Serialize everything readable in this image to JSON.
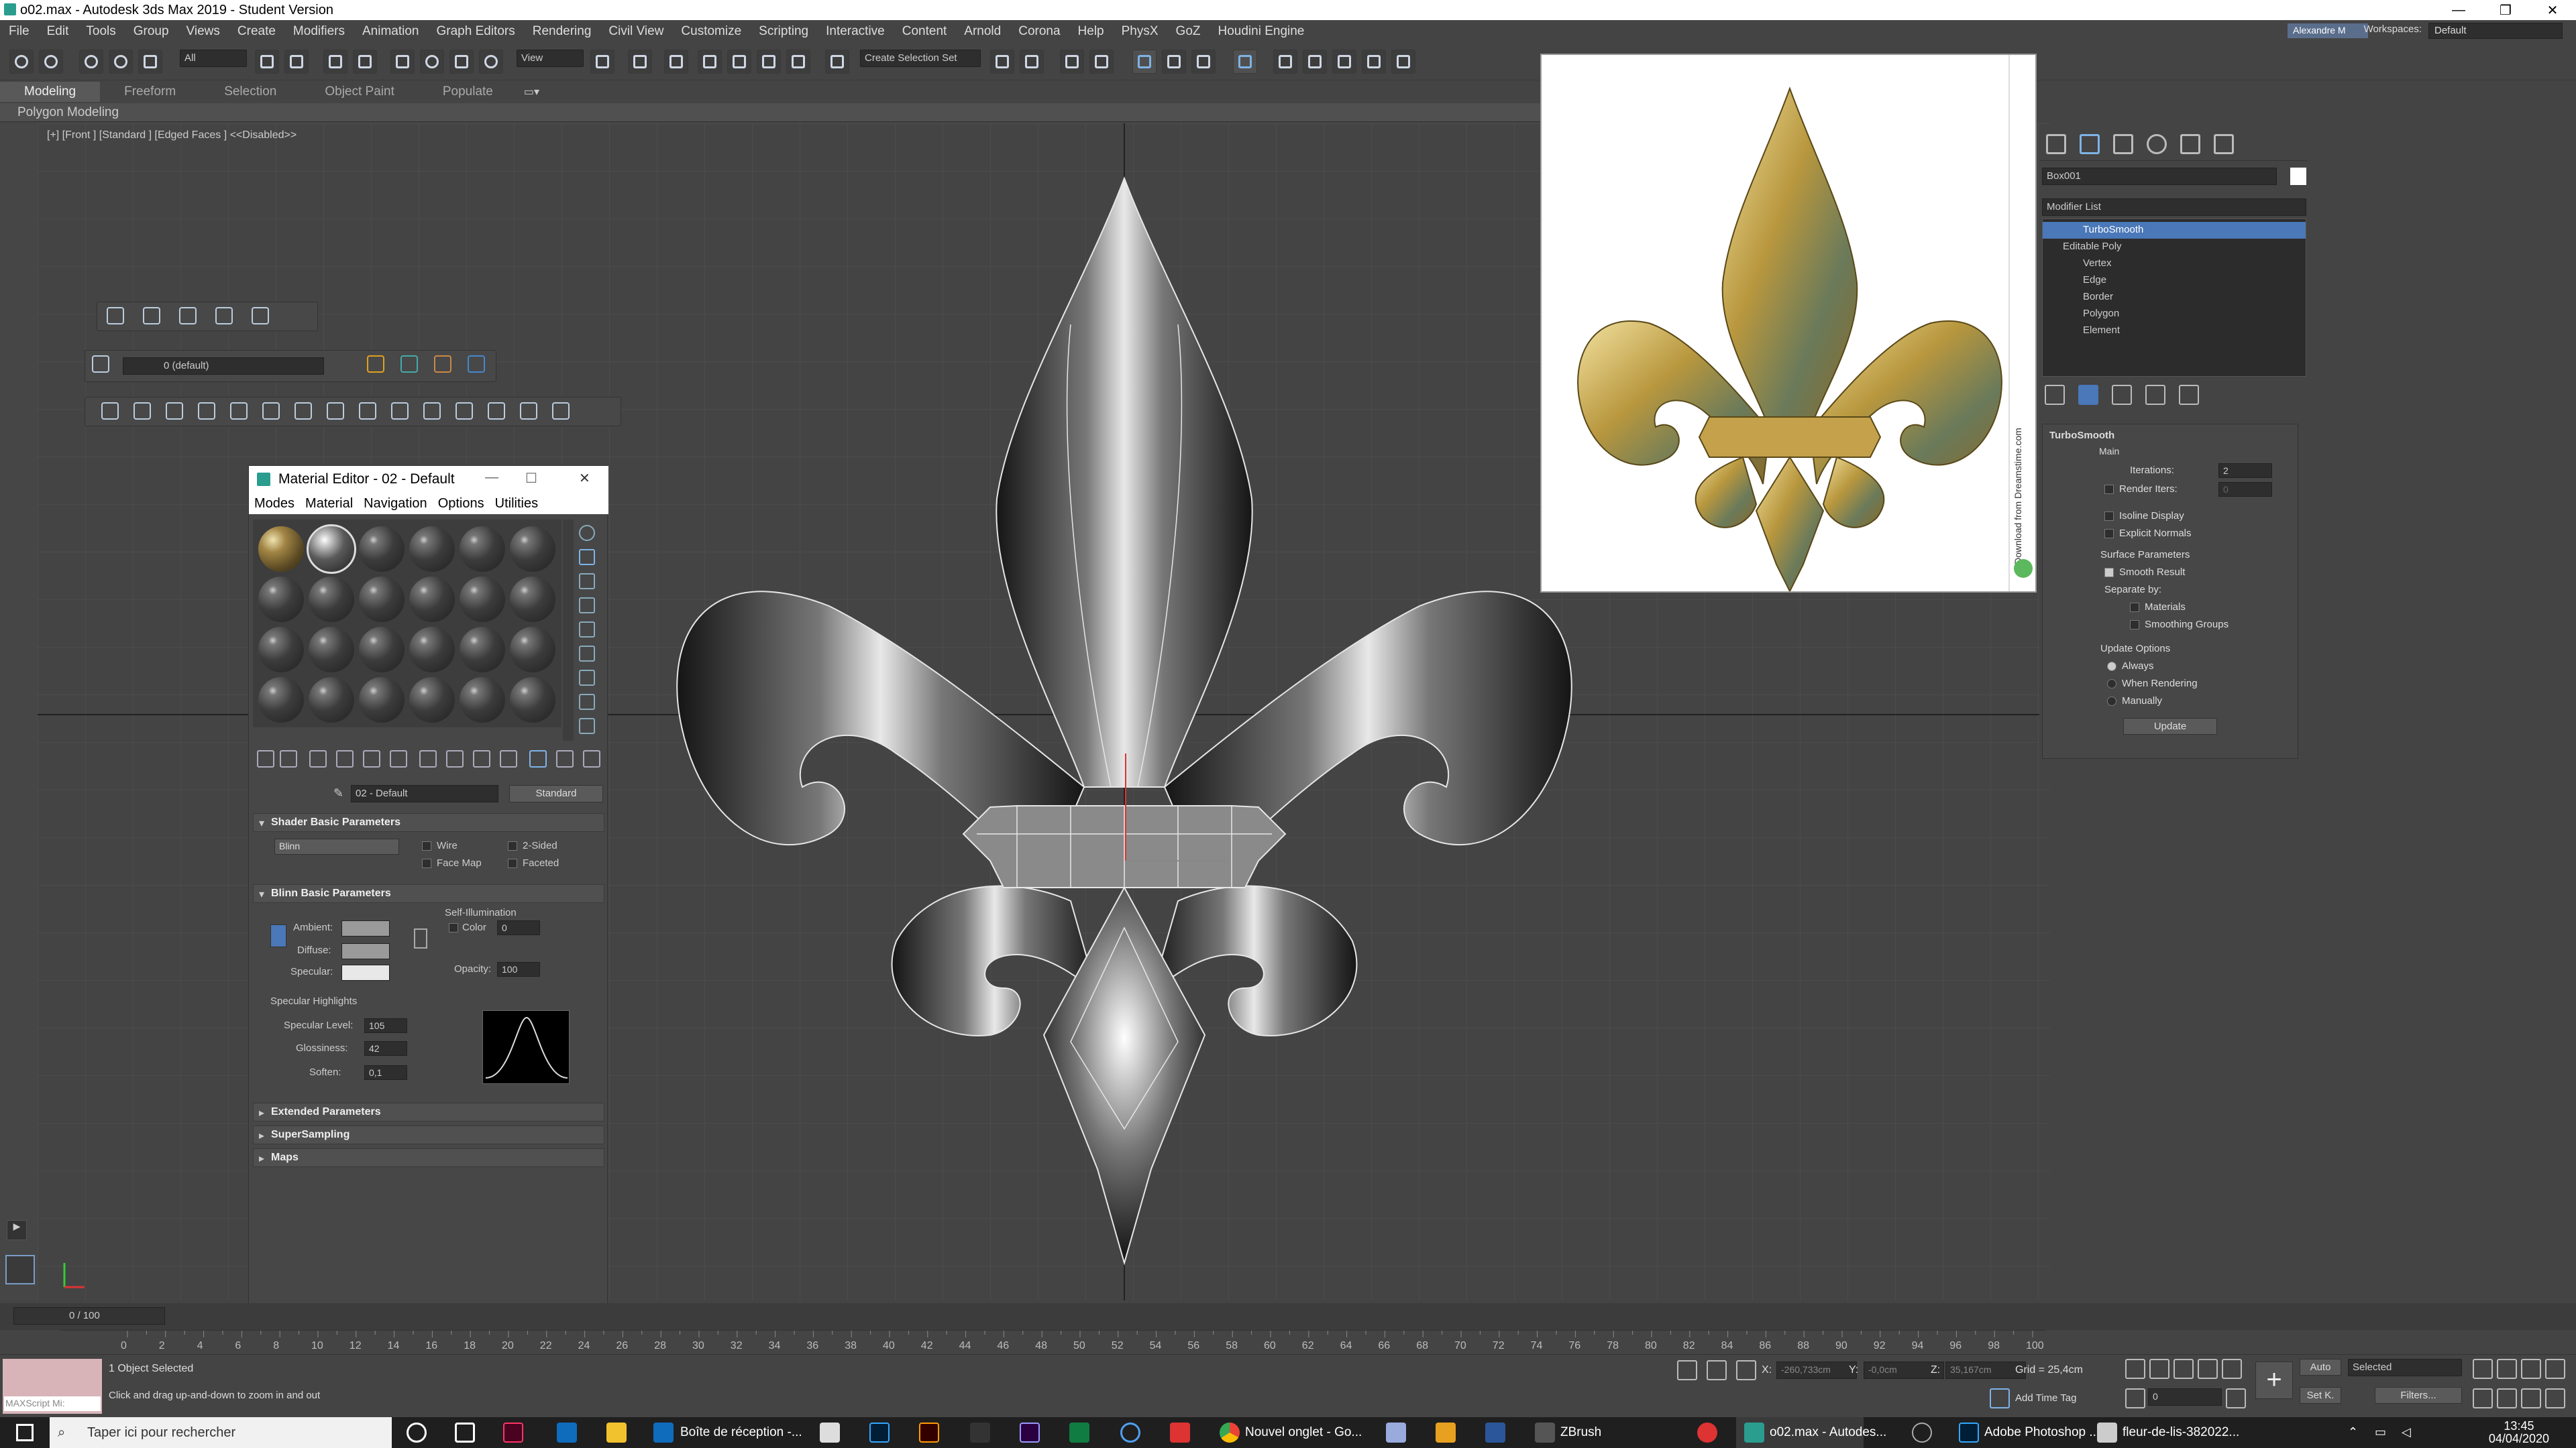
{
  "window": {
    "title": "o02.max - Autodesk 3ds Max 2019 - Student Version"
  },
  "menu": [
    "File",
    "Edit",
    "Tools",
    "Group",
    "Views",
    "Create",
    "Modifiers",
    "Animation",
    "Graph Editors",
    "Rendering",
    "Civil View",
    "Customize",
    "Scripting",
    "Interactive",
    "Content",
    "Arnold",
    "Corona",
    "Help",
    "PhysX",
    "GoZ",
    "Houdini Engine"
  ],
  "user": "Alexandre M",
  "workspaces": {
    "label": "Workspaces:",
    "value": "Default"
  },
  "toolbar": {
    "filter": "All",
    "view": "View",
    "selection_set": "Create Selection Set"
  },
  "ribbon": {
    "tabs": [
      "Modeling",
      "Freeform",
      "Selection",
      "Object Paint",
      "Populate"
    ],
    "sub": "Polygon Modeling"
  },
  "viewport": {
    "label": "[+] [Front ] [Standard ] [Edged Faces ]  <<Disabled>>"
  },
  "layer": {
    "name": "0 (default)"
  },
  "command_panel": {
    "object_name": "Box001",
    "modifier_list": "Modifier List",
    "stack": [
      "TurboSmooth",
      "Editable Poly",
      "Vertex",
      "Edge",
      "Border",
      "Polygon",
      "Element"
    ],
    "turbosmooth": {
      "title": "TurboSmooth",
      "main": "Main",
      "iterations_label": "Iterations:",
      "iterations": "2",
      "render_iters_label": "Render Iters:",
      "render_iters": "0",
      "isoline": "Isoline Display",
      "explicit_normals": "Explicit Normals",
      "surface": "Surface Parameters",
      "smooth_result": "Smooth Result",
      "separate_by": "Separate by:",
      "materials": "Materials",
      "smoothing_groups": "Smoothing Groups",
      "update_options": "Update Options",
      "always": "Always",
      "when_rendering": "When Rendering",
      "manually": "Manually",
      "update_btn": "Update"
    }
  },
  "reference": {
    "watermark": "Download from Dreamstime.com"
  },
  "material_editor": {
    "title": "Material Editor - 02 - Default",
    "menu": [
      "Modes",
      "Material",
      "Navigation",
      "Options",
      "Utilities"
    ],
    "material_name": "02 - Default",
    "material_type": "Standard",
    "shader_basic": "Shader Basic Parameters",
    "shader": "Blinn",
    "wire": "Wire",
    "two_sided": "2-Sided",
    "face_map": "Face Map",
    "faceted": "Faceted",
    "blinn_basic": "Blinn Basic Parameters",
    "self_illum": "Self-Illumination",
    "color": "Color",
    "color_val": "0",
    "ambient": "Ambient:",
    "diffuse": "Diffuse:",
    "specular": "Specular:",
    "opacity_label": "Opacity:",
    "opacity": "100",
    "spec_highlights": "Specular Highlights",
    "spec_level_label": "Specular Level:",
    "spec_level": "105",
    "glossiness_label": "Glossiness:",
    "glossiness": "42",
    "soften_label": "Soften:",
    "soften": "0,1",
    "extended": "Extended Parameters",
    "supersampling": "SuperSampling",
    "maps": "Maps"
  },
  "timeline": {
    "frame": "0 / 100",
    "ticks": [
      "0",
      "2",
      "4",
      "6",
      "8",
      "10",
      "12",
      "14",
      "16",
      "18",
      "20",
      "22",
      "24",
      "26",
      "28",
      "30",
      "32",
      "34",
      "36",
      "38",
      "40",
      "42",
      "44",
      "46",
      "48",
      "50",
      "52",
      "54",
      "56",
      "58",
      "60",
      "62",
      "64",
      "66",
      "68",
      "70",
      "72",
      "74",
      "76",
      "78",
      "80",
      "82",
      "84",
      "86",
      "88",
      "90",
      "92",
      "94",
      "96",
      "98",
      "100"
    ]
  },
  "status": {
    "selected": "1 Object Selected",
    "hint": "Click and drag up-and-down to zoom in and out",
    "maxscript": "MAXScript Mi:",
    "x_label": "X:",
    "x": "-260,733cm",
    "y_label": "Y:",
    "y": "-0,0cm",
    "z_label": "Z:",
    "z": "35,167cm",
    "grid": "Grid = 25,4cm",
    "add_time_tag": "Add Time Tag",
    "auto": "Auto",
    "set_key": "Set K.",
    "key_filter": "Selected",
    "filters": "Filters...",
    "frame_spin": "0"
  },
  "taskbar": {
    "search": "Taper ici pour rechercher",
    "apps": [
      "Boîte de réception -...",
      "Nouvel onglet - Go...",
      "ZBrush",
      "o02.max - Autodes...",
      "Adobe Photoshop ...",
      "fleur-de-lis-382022..."
    ],
    "time": "13:45",
    "date": "04/04/2020"
  },
  "colors": {
    "accent": "#4a78b8",
    "bg": "#444444",
    "gold": "#b8973e"
  }
}
